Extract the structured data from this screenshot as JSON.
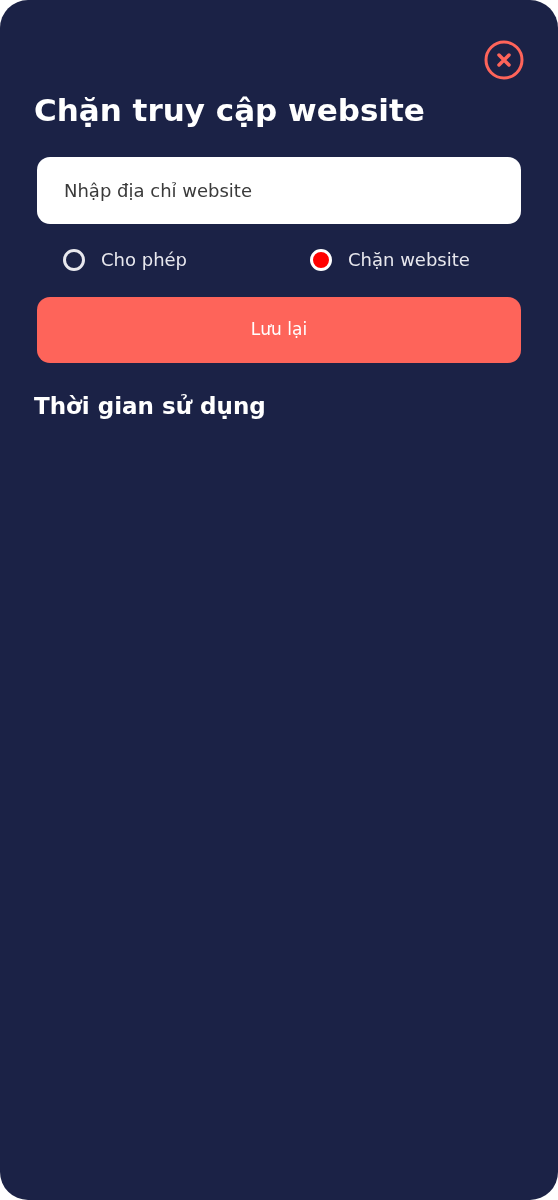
{
  "title": "Chặn truy cập website",
  "url_field": {
    "placeholder": "Nhập địa chỉ website"
  },
  "modes": [
    {
      "label": "Cho phép",
      "selected": false
    },
    {
      "label": "Chặn website",
      "selected": true
    }
  ],
  "save_button": "Lưu lại",
  "usage_section": {
    "title": "Thời gian sử dụng"
  }
}
